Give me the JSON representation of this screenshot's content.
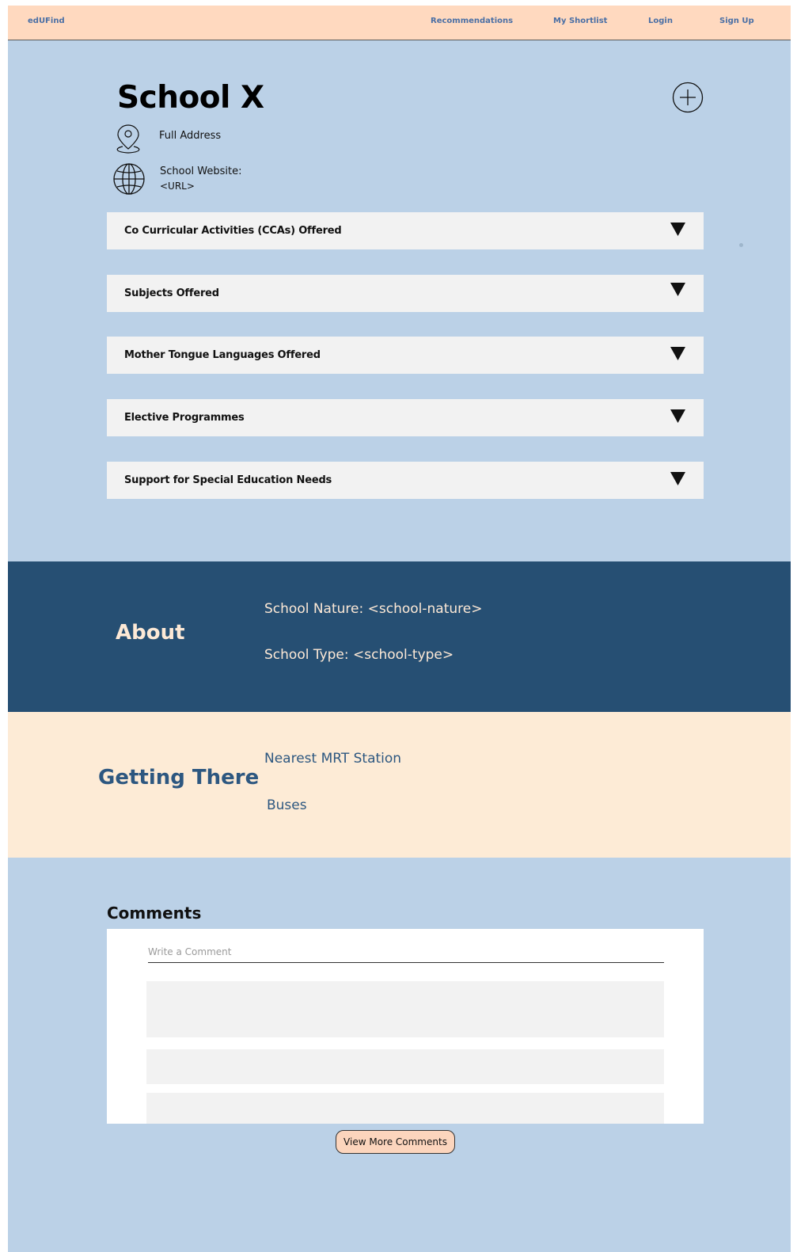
{
  "header": {
    "brand": "edUFind",
    "nav": [
      "Recommendations",
      "My Shortlist",
      "Login",
      "Sign Up"
    ]
  },
  "school": {
    "name": "School X",
    "address": "Full Address",
    "website_label": "School Website:",
    "website_url": "<URL>"
  },
  "accordions": [
    "Co Curricular Activities (CCAs) Offered",
    "Subjects Offered",
    "Mother Tongue Languages Offered",
    "Elective Programmes",
    "Support for Special Education Needs"
  ],
  "about": {
    "title": "About",
    "nature": "School Nature: <school-nature>",
    "type": "School Type:  <school-type>"
  },
  "getting_there": {
    "title": "Getting There",
    "mrt": "Nearest MRT Station",
    "buses": "Buses"
  },
  "comments": {
    "title": "Comments",
    "placeholder": "Write a Comment",
    "view_more": "View More Comments"
  },
  "colors": {
    "page_bg": "#bbd1e7",
    "header_bg": "#ffd9bf",
    "about_bg": "#264f73",
    "getting_bg": "#fdebd6",
    "accent_text": "#2d5780"
  }
}
